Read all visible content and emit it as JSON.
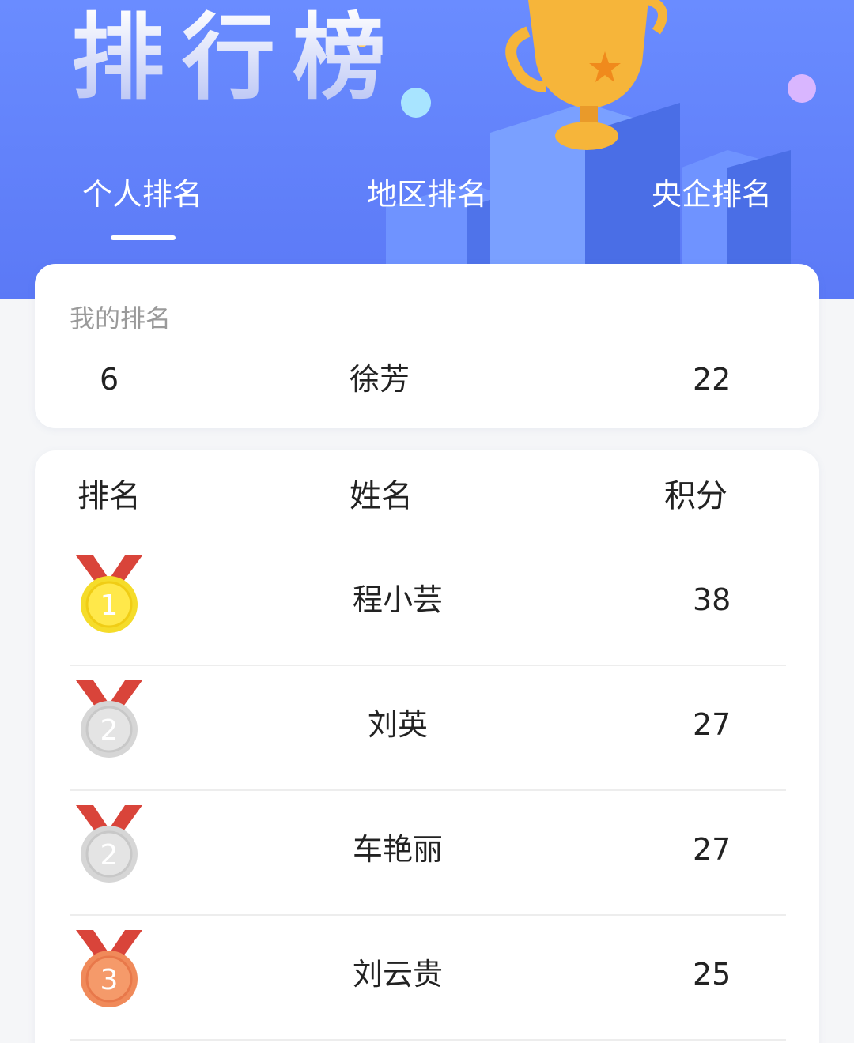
{
  "header": {
    "title": "排行榜",
    "colors": {
      "bg_top": "#6a8cff",
      "bg_bottom": "#5b79f6"
    }
  },
  "tabs": [
    {
      "label": "个人排名",
      "active": true
    },
    {
      "label": "地区排名",
      "active": false
    },
    {
      "label": "央企排名",
      "active": false
    }
  ],
  "my_rank": {
    "label": "我的排名",
    "rank": "6",
    "name": "徐芳",
    "score": "22"
  },
  "table": {
    "headers": {
      "rank": "排名",
      "name": "姓名",
      "score": "积分"
    },
    "rows": [
      {
        "medal": "gold-medal-icon",
        "medal_number": "1",
        "name": "程小芸",
        "score": "38"
      },
      {
        "medal": "silver-medal-icon",
        "medal_number": "2",
        "name": "刘英",
        "score": "27"
      },
      {
        "medal": "silver-medal-icon",
        "medal_number": "2",
        "name": "车艳丽",
        "score": "27"
      },
      {
        "medal": "bronze-medal-icon",
        "medal_number": "3",
        "name": "刘云贵",
        "score": "25"
      }
    ]
  }
}
